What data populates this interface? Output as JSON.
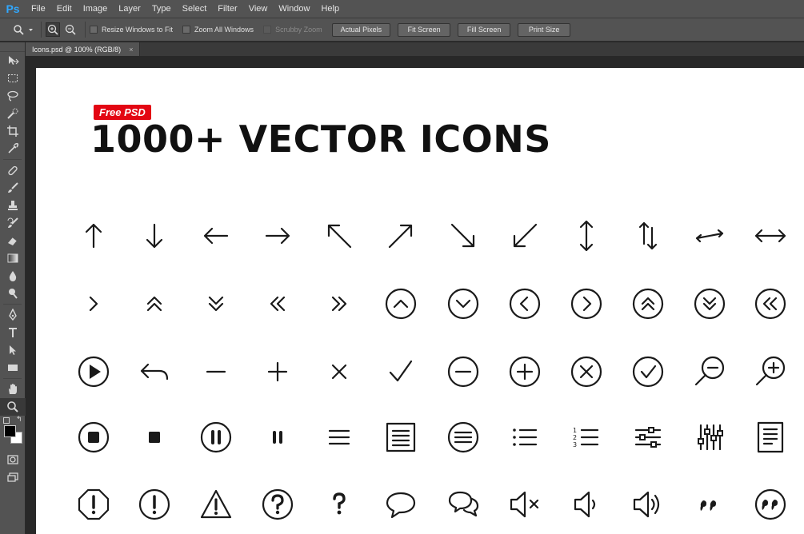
{
  "app": {
    "logo": "Ps"
  },
  "menu": [
    "File",
    "Edit",
    "Image",
    "Layer",
    "Type",
    "Select",
    "Filter",
    "View",
    "Window",
    "Help"
  ],
  "options": {
    "checks": [
      {
        "label": "Resize Windows to Fit",
        "checked": false,
        "disabled": false
      },
      {
        "label": "Zoom All Windows",
        "checked": false,
        "disabled": false
      },
      {
        "label": "Scrubby Zoom",
        "checked": false,
        "disabled": true
      }
    ],
    "buttons": [
      "Actual Pixels",
      "Fit Screen",
      "Fill Screen",
      "Print Size"
    ]
  },
  "document": {
    "tab_title": "Icons.psd @ 100% (RGB/8)",
    "close_glyph": "×"
  },
  "artwork": {
    "badge": "Free PSD",
    "headline": "1000+ VECTOR ICONS",
    "badge_color": "#e30613",
    "icon_rows": [
      [
        "arrow-up-icon",
        "arrow-down-icon",
        "arrow-left-icon",
        "arrow-right-icon",
        "arrow-up-left-icon",
        "arrow-up-right-icon",
        "arrow-down-right-icon",
        "arrow-down-left-icon",
        "arrow-up-down-icon",
        "arrows-up-down-swap-icon",
        "arrows-left-right-swap-icon",
        "arrow-left-right-icon"
      ],
      [
        "chevron-right-icon",
        "chevron-double-up-icon",
        "chevron-double-down-icon",
        "chevron-double-left-icon",
        "chevron-double-right-icon",
        "circle-chevron-up-icon",
        "circle-chevron-down-icon",
        "circle-chevron-left-icon",
        "circle-chevron-right-icon",
        "circle-double-up-icon",
        "circle-double-down-icon",
        "circle-double-left-icon"
      ],
      [
        "circle-play-icon",
        "reply-icon",
        "minus-icon",
        "plus-icon",
        "close-icon",
        "check-icon",
        "circle-minus-icon",
        "circle-plus-icon",
        "circle-close-icon",
        "circle-check-icon",
        "zoom-out-icon",
        "zoom-in-icon"
      ],
      [
        "circle-stop-icon",
        "stop-icon",
        "circle-pause-icon",
        "pause-icon",
        "menu-icon",
        "document-list-icon",
        "circle-menu-icon",
        "bullet-list-icon",
        "numbered-list-icon",
        "sliders-horizontal-icon",
        "sliders-vertical-icon",
        "document-text-icon"
      ],
      [
        "octagon-alert-icon",
        "circle-alert-icon",
        "triangle-alert-icon",
        "circle-question-icon",
        "question-icon",
        "speech-bubble-icon",
        "speech-bubbles-icon",
        "speaker-mute-icon",
        "speaker-icon",
        "speaker-low-icon",
        "quote-icon",
        "circle-quote-icon"
      ]
    ]
  }
}
